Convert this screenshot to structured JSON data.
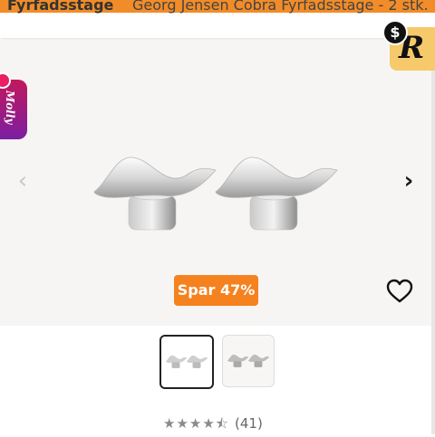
{
  "header": {
    "breadcrumb_left": "Fyrfadsstage",
    "breadcrumb_right": "Georg Jensen Cobra Fyrfadsstage - 2 stk."
  },
  "extensions": {
    "molly_label": "Molly",
    "rakuten_letter": "R",
    "dollar_symbol": "$"
  },
  "gallery": {
    "prev_icon": "chevron-left-icon",
    "next_icon": "chevron-right-icon",
    "prev_glyph": "‹",
    "next_glyph": "›",
    "discount_label": "Spar 47%",
    "wishlist_icon": "heart-outline-icon",
    "thumbnail_count": 2,
    "selected_thumbnail": 1
  },
  "rating": {
    "stars_value": 4.5,
    "stars_max": 5,
    "stars_glyphs": "★★★★⯪",
    "count": "(41)"
  },
  "colors": {
    "accent_orange": "#f5821f",
    "background_gray": "#f7f5f3",
    "molly_gradient_top": "#c2185b",
    "molly_gradient_bottom": "#7b1fa2",
    "rakuten_yellow": "#f6c96b"
  }
}
